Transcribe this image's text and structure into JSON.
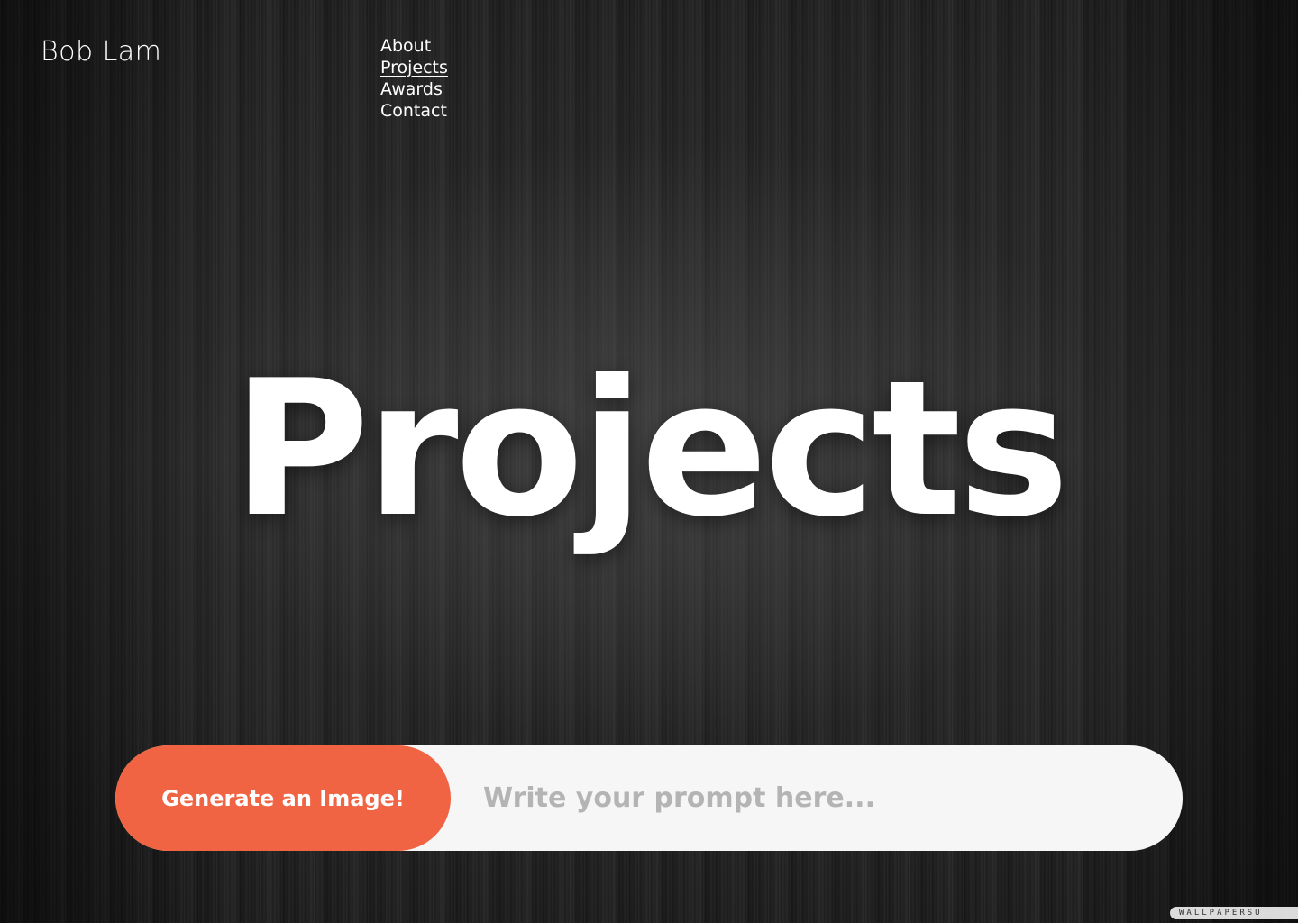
{
  "header": {
    "brand": "Bob Lam"
  },
  "nav": {
    "items": [
      {
        "label": "About",
        "active": false
      },
      {
        "label": "Projects",
        "active": true
      },
      {
        "label": "Awards",
        "active": false
      },
      {
        "label": "Contact",
        "active": false
      }
    ]
  },
  "hero": {
    "title": "Projects"
  },
  "prompt": {
    "button_label": "Generate an Image!",
    "placeholder": "Write your prompt here...",
    "value": ""
  },
  "background": {
    "watermark": "WALLPAPERSU"
  },
  "colors": {
    "accent": "#f16443",
    "input_bg": "#f6f6f6",
    "placeholder": "#b4b4b4",
    "text": "#ffffff"
  }
}
